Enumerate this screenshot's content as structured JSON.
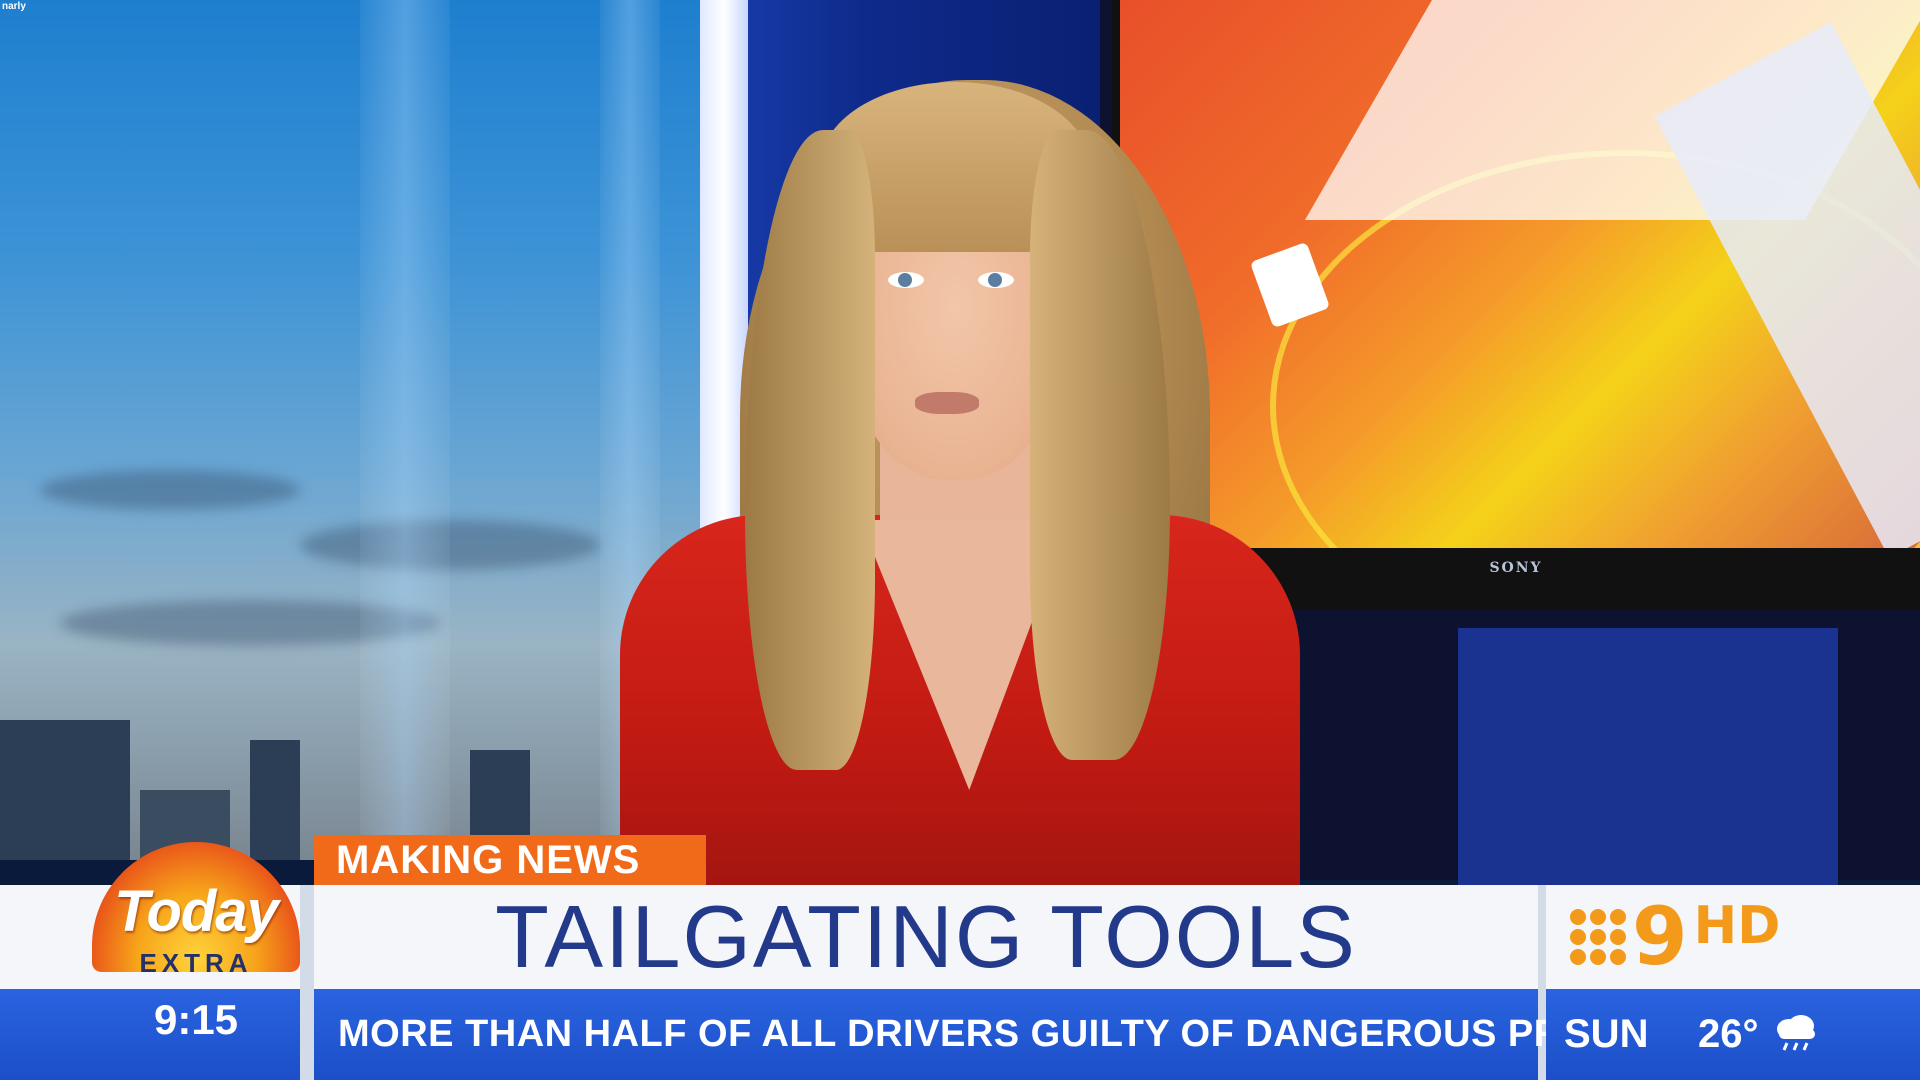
{
  "watermark": "narly",
  "monitor": {
    "brand": "SONY"
  },
  "lower_third": {
    "kicker": "MAKING NEWS",
    "headline": "TAILGATING TOOLS",
    "subheadline": "MORE THAN HALF OF ALL DRIVERS GUILTY OF DANGEROUS PRACTICE"
  },
  "show_logo": {
    "name": "Today",
    "suffix": "EXTRA",
    "time": "9:15"
  },
  "network": {
    "logo_number": "9",
    "logo_hd": "HD"
  },
  "weather": {
    "day": "SUN",
    "temperature": "26°",
    "icon": "cloud-rain-icon"
  },
  "colors": {
    "accent_orange": "#f06a1a",
    "headline_blue": "#233a8a",
    "bar_blue": "#1c4fc8",
    "presenter_dress": "#c01a12"
  }
}
